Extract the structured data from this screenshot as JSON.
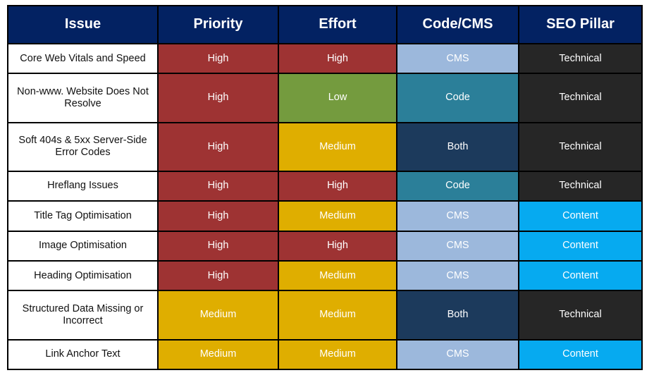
{
  "table": {
    "columns": [
      {
        "key": "issue",
        "label": "Issue"
      },
      {
        "key": "priority",
        "label": "Priority"
      },
      {
        "key": "effort",
        "label": "Effort"
      },
      {
        "key": "codecms",
        "label": "Code/CMS"
      },
      {
        "key": "pillar",
        "label": "SEO Pillar"
      }
    ],
    "rows": [
      {
        "issue": "Core Web Vitals and Speed",
        "priority": "High",
        "priority_color": "#9E3333",
        "effort": "High",
        "effort_color": "#9E3333",
        "codecms": "CMS",
        "codecms_color": "#9CB8DC",
        "pillar": "Technical",
        "pillar_color": "#262626"
      },
      {
        "issue": "Non-www. Website Does Not Resolve",
        "priority": "High",
        "priority_color": "#9E3333",
        "effort": "Low",
        "effort_color": "#749B3E",
        "codecms": "Code",
        "codecms_color": "#2B7F99",
        "pillar": "Technical",
        "pillar_color": "#262626"
      },
      {
        "issue": "Soft 404s & 5xx Server-Side Error Codes",
        "priority": "High",
        "priority_color": "#9E3333",
        "effort": "Medium",
        "effort_color": "#DFAE00",
        "codecms": "Both",
        "codecms_color": "#1C3A5C",
        "pillar": "Technical",
        "pillar_color": "#262626"
      },
      {
        "issue": "Hreflang Issues",
        "priority": "High",
        "priority_color": "#9E3333",
        "effort": "High",
        "effort_color": "#9E3333",
        "codecms": "Code",
        "codecms_color": "#2B7F99",
        "pillar": "Technical",
        "pillar_color": "#262626"
      },
      {
        "issue": "Title Tag Optimisation",
        "priority": "High",
        "priority_color": "#9E3333",
        "effort": "Medium",
        "effort_color": "#DFAE00",
        "codecms": "CMS",
        "codecms_color": "#9CB8DC",
        "pillar": "Content",
        "pillar_color": "#06AAF0"
      },
      {
        "issue": "Image Optimisation",
        "priority": "High",
        "priority_color": "#9E3333",
        "effort": "High",
        "effort_color": "#9E3333",
        "codecms": "CMS",
        "codecms_color": "#9CB8DC",
        "pillar": "Content",
        "pillar_color": "#06AAF0"
      },
      {
        "issue": "Heading Optimisation",
        "priority": "High",
        "priority_color": "#9E3333",
        "effort": "Medium",
        "effort_color": "#DFAE00",
        "codecms": "CMS",
        "codecms_color": "#9CB8DC",
        "pillar": "Content",
        "pillar_color": "#06AAF0"
      },
      {
        "issue": "Structured Data Missing or Incorrect",
        "priority": "Medium",
        "priority_color": "#DFAE00",
        "effort": "Medium",
        "effort_color": "#DFAE00",
        "codecms": "Both",
        "codecms_color": "#1C3A5C",
        "pillar": "Technical",
        "pillar_color": "#262626"
      },
      {
        "issue": "Link Anchor Text",
        "priority": "Medium",
        "priority_color": "#DFAE00",
        "effort": "Medium",
        "effort_color": "#DFAE00",
        "codecms": "CMS",
        "codecms_color": "#9CB8DC",
        "pillar": "Content",
        "pillar_color": "#06AAF0"
      }
    ]
  },
  "colors": {
    "header_bg": "#032262",
    "header_text": "#FFFFFF",
    "grid_line": "#000000",
    "issue_bg": "#FFFFFF",
    "issue_text": "#111111",
    "high": "#9E3333",
    "medium": "#DFAE00",
    "low": "#749B3E",
    "cms": "#9CB8DC",
    "code": "#2B7F99",
    "both": "#1C3A5C",
    "technical": "#262626",
    "content": "#06AAF0"
  }
}
